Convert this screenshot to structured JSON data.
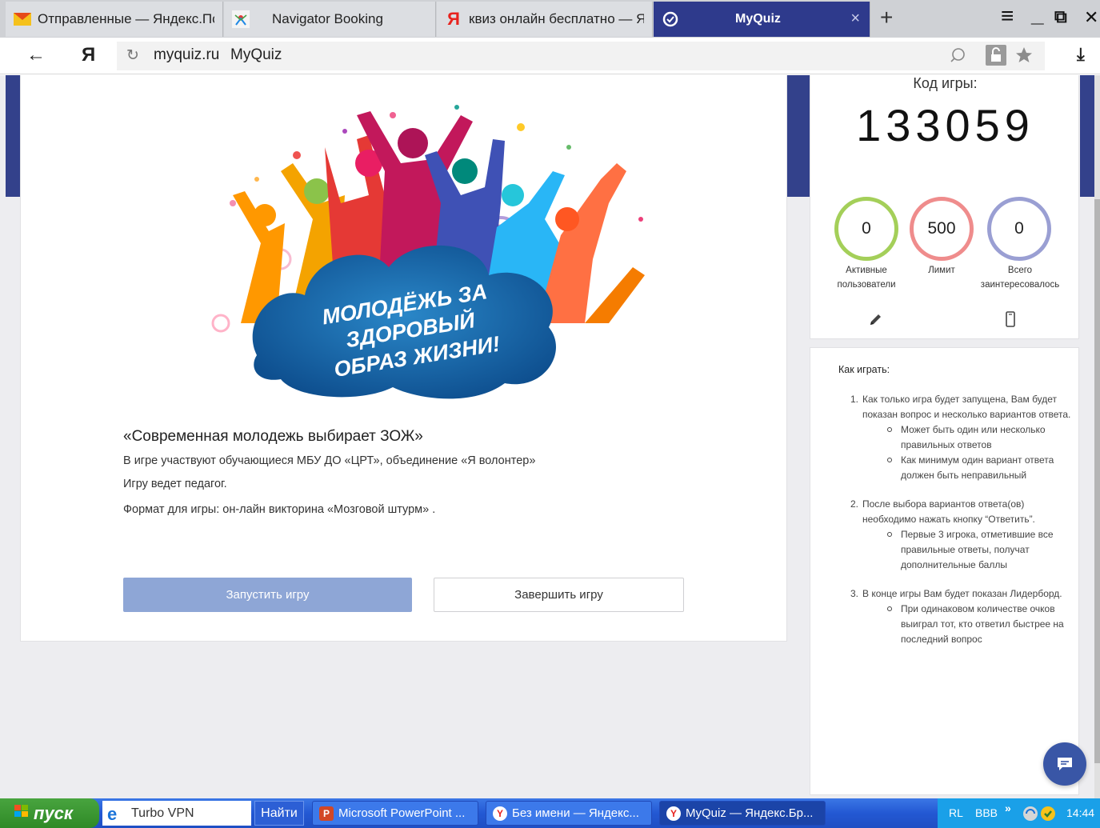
{
  "browser": {
    "tabs": [
      {
        "label": "Отправленные — Яндекс.Пс"
      },
      {
        "label": "Navigator Booking"
      },
      {
        "label": "квиз онлайн бесплатно — Я"
      },
      {
        "label": "MyQuiz"
      }
    ],
    "new_tab_symbol": "+",
    "close_symbol": "×",
    "menu_symbol": "≡",
    "minimize_symbol": "_",
    "restore_symbol": "⧉",
    "window_close_symbol": "✕",
    "address": {
      "back_symbol": "←",
      "yandex_symbol": "Я",
      "reload_symbol": "↻",
      "domain": "myquiz.ru",
      "page_title": "MyQuiz",
      "download_symbol": "⤓"
    }
  },
  "quiz": {
    "banner_text": [
      "МОЛОДЁЖЬ ЗА",
      "ЗДОРОВЫЙ",
      "ОБРАЗ ЖИЗНИ!"
    ],
    "title": "«Современная молодежь выбирает ЗОЖ»",
    "lines": [
      "В игре участвуют обучающиеся МБУ ДО «ЦРТ», объединение «Я волонтер»",
      "Игру ведет педагог.",
      "Формат для игры: он-лайн викторина «Мозговой штурм» ."
    ],
    "start_label": "Запустить игру",
    "end_label": "Завершить игру"
  },
  "game": {
    "code_label": "Код игры:",
    "code": "133059",
    "stats": [
      {
        "value": "0",
        "label_lines": [
          "Активные",
          "пользователи"
        ],
        "color": "#a4cf59"
      },
      {
        "value": "500",
        "label_lines": [
          "Лимит"
        ],
        "color": "#ef8c8c"
      },
      {
        "value": "0",
        "label_lines": [
          "Всего",
          "заинтересовалось"
        ],
        "color": "#9a9fd3"
      }
    ]
  },
  "howto": {
    "title": "Как играть:",
    "items": [
      {
        "num": "1.",
        "text": "Как только игра будет запущена, Вам будет показан вопрос и несколько вариантов ответа.",
        "subs": [
          "Может быть один или несколько правильных ответов",
          "Как минимум один вариант ответа должен быть неправильный"
        ]
      },
      {
        "num": "2.",
        "text": "После выбора вариантов ответа(ов) необходимо нажать кнопку “Ответить”.",
        "subs": [
          "Первые 3 игрока, отметившие все правильные ответы, получат дополнительные баллы"
        ]
      },
      {
        "num": "3.",
        "text": "В конце игры Вам будет показан Лидерборд.",
        "subs": [
          "При одинаковом количестве очков выиграл тот, кто ответил быстрее на последний вопрос"
        ]
      }
    ]
  },
  "taskbar": {
    "start_label": "пуск",
    "quick_label": "Turbo VPN",
    "find_label": "Найти",
    "tasks": [
      {
        "label": "Microsoft PowerPoint ..."
      },
      {
        "label": "Без имени — Яндекс..."
      },
      {
        "label": "MyQuiz — Яндекс.Бр..."
      }
    ],
    "tray": {
      "lang": "RL",
      "kb": "BBB",
      "chevron": "»",
      "time": "14:44"
    }
  }
}
